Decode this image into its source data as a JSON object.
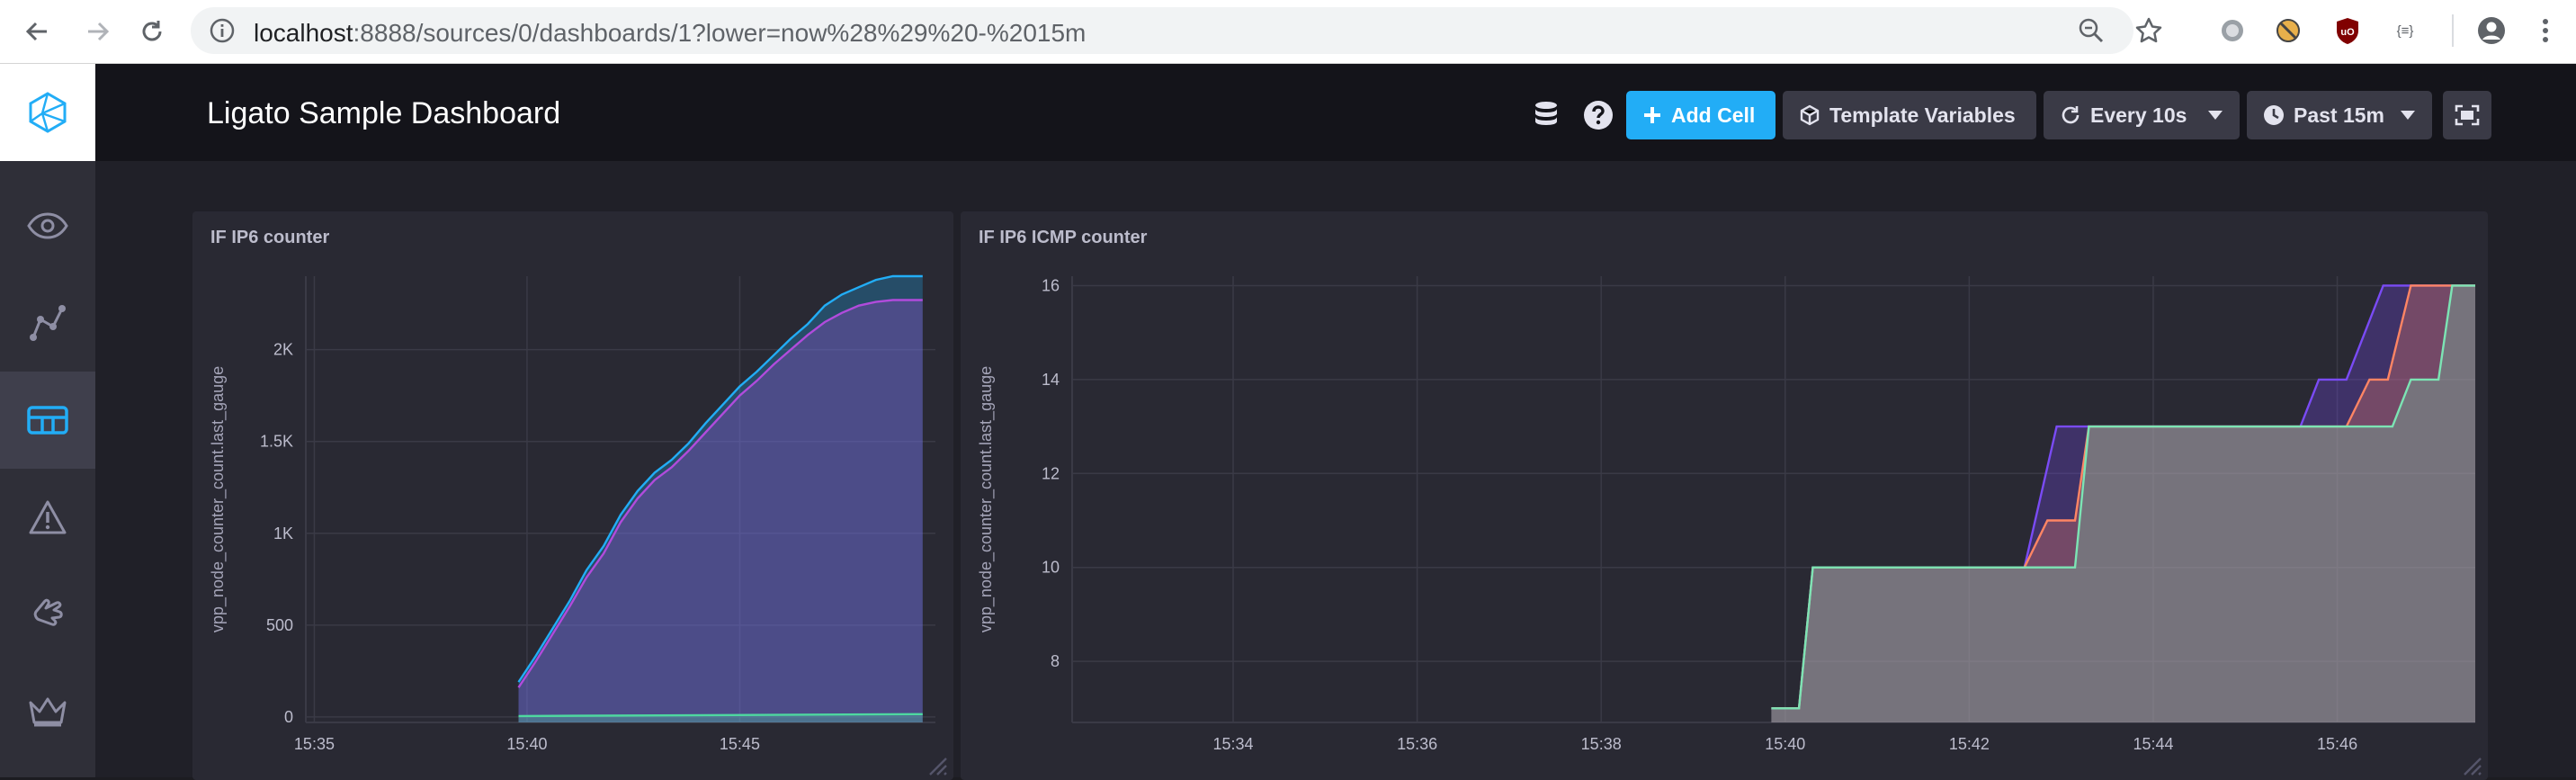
{
  "browser": {
    "url_host": "localhost",
    "url_rest": ":8888/sources/0/dashboards/1?lower=now%28%29%20-%2015m"
  },
  "sidebar": {
    "items": [
      {
        "name": "eye-icon"
      },
      {
        "name": "graph-icon"
      },
      {
        "name": "dashboards-icon",
        "active": true
      },
      {
        "name": "alert-icon"
      },
      {
        "name": "hand-icon"
      },
      {
        "name": "crown-icon"
      }
    ]
  },
  "header": {
    "title": "Ligato Sample Dashboard",
    "add_cell_label": "Add Cell",
    "template_variables_label": "Template Variables",
    "refresh_label": "Every 10s",
    "time_range_label": "Past 15m"
  },
  "colors": {
    "accent": "#22adf6",
    "series_blue": "#22adf6",
    "series_magenta": "#b14bdc",
    "series_cyan": "#4ed8a0",
    "series_purple": "#7a4bf5",
    "series_salmon": "#ff8564",
    "series_mint": "#7ce4b4"
  },
  "cells": [
    {
      "title": "IF IP6 counter",
      "chart_data": {
        "type": "area",
        "title": "IF IP6 counter",
        "ylabel": "vpp_node_counter_count.last_gauge",
        "xlabel": "",
        "x_ticks": [
          "15:35",
          "15:40",
          "15:45"
        ],
        "y_ticks": [
          "0",
          "500",
          "1K",
          "1.5K",
          "2K"
        ],
        "ylim": [
          -30,
          2400
        ],
        "x_range_minutes": [
          -0.2,
          14.6
        ],
        "x_tick_positions_minutes": [
          0,
          5,
          10
        ],
        "grid": true,
        "series": [
          {
            "color": "#22adf6",
            "x": [
              4.8,
              4.8,
              5.2,
              5.2,
              5.6,
              5.6,
              6.0,
              6.0,
              6.4,
              6.4,
              6.8,
              6.8,
              7.2,
              7.2,
              7.6,
              7.6,
              8.0,
              8.0,
              8.4,
              8.4,
              8.8,
              8.8,
              9.2,
              9.2,
              9.6,
              9.6,
              10.0,
              10.0,
              10.4,
              10.4,
              10.8,
              10.8,
              11.2,
              11.2,
              11.6,
              11.6,
              12.0,
              12.0,
              12.4,
              12.4,
              12.8,
              12.8,
              13.2,
              13.2,
              13.6,
              13.6,
              14.0,
              14.0,
              14.3
            ],
            "y": [
              190,
              190,
              330,
              330,
              480,
              480,
              630,
              630,
              800,
              800,
              930,
              930,
              1100,
              1100,
              1230,
              1230,
              1330,
              1330,
              1400,
              1400,
              1490,
              1490,
              1600,
              1600,
              1700,
              1700,
              1800,
              1800,
              1880,
              1880,
              1970,
              1970,
              2060,
              2060,
              2140,
              2140,
              2240,
              2240,
              2300,
              2300,
              2340,
              2340,
              2380,
              2380,
              2400,
              2400,
              2400,
              2400,
              2400
            ]
          },
          {
            "color": "#b14bdc",
            "x": [
              4.8,
              4.8,
              5.2,
              5.2,
              5.6,
              5.6,
              6.0,
              6.0,
              6.4,
              6.4,
              6.8,
              6.8,
              7.2,
              7.2,
              7.6,
              7.6,
              8.0,
              8.0,
              8.4,
              8.4,
              8.8,
              8.8,
              9.2,
              9.2,
              9.6,
              9.6,
              10.0,
              10.0,
              10.4,
              10.4,
              10.8,
              10.8,
              11.2,
              11.2,
              11.6,
              11.6,
              12.0,
              12.0,
              12.4,
              12.4,
              12.8,
              12.8,
              13.2,
              13.2,
              13.6,
              13.6,
              14.0,
              14.0,
              14.3
            ],
            "y": [
              160,
              160,
              300,
              300,
              450,
              450,
              600,
              600,
              760,
              760,
              890,
              890,
              1060,
              1060,
              1190,
              1190,
              1290,
              1290,
              1360,
              1360,
              1450,
              1450,
              1550,
              1550,
              1650,
              1650,
              1750,
              1750,
              1830,
              1830,
              1920,
              1920,
              2000,
              2000,
              2080,
              2080,
              2150,
              2150,
              2200,
              2200,
              2240,
              2240,
              2260,
              2260,
              2270,
              2270,
              2270,
              2270,
              2270
            ]
          },
          {
            "color": "#4ed8a0",
            "x": [
              4.8,
              14.3
            ],
            "y": [
              5,
              15
            ]
          }
        ]
      }
    },
    {
      "title": "IF IP6 ICMP counter",
      "chart_data": {
        "type": "area",
        "title": "IF IP6 ICMP counter",
        "ylabel": "vpp_node_counter_count.last_gauge",
        "xlabel": "",
        "x_ticks": [
          "15:34",
          "15:36",
          "15:38",
          "15:40",
          "15:42",
          "15:44",
          "15:46"
        ],
        "y_ticks": [
          "8",
          "10",
          "12",
          "14",
          "16"
        ],
        "ylim": [
          6.7,
          16.2
        ],
        "x_range_minutes": [
          -1.75,
          13.5
        ],
        "x_tick_positions_minutes": [
          0,
          2,
          4,
          6,
          8,
          10,
          12
        ],
        "grid": true,
        "series": [
          {
            "color": "#7a4bf5",
            "x": [
              5.85,
              6.15,
              6.3,
              8.6,
              8.95,
              11.6,
              11.8,
              12.1,
              12.5,
              13.1,
              13.5
            ],
            "y": [
              7,
              7,
              10,
              10,
              13,
              13,
              14,
              14,
              16,
              16,
              16
            ]
          },
          {
            "color": "#ff8564",
            "x": [
              5.85,
              6.15,
              6.3,
              8.6,
              8.85,
              9.15,
              9.3,
              11.6,
              12.1,
              12.35,
              12.55,
              12.8,
              13.1,
              13.5
            ],
            "y": [
              7,
              7,
              10,
              10,
              11,
              11,
              13,
              13,
              13,
              14,
              14,
              16,
              16,
              16
            ]
          },
          {
            "color": "#7ce4b4",
            "x": [
              5.85,
              6.15,
              6.3,
              9.15,
              9.3,
              12.6,
              12.8,
              13.1,
              13.25,
              13.5
            ],
            "y": [
              7,
              7,
              10,
              10,
              13,
              13,
              14,
              14,
              16,
              16
            ]
          }
        ]
      }
    }
  ]
}
